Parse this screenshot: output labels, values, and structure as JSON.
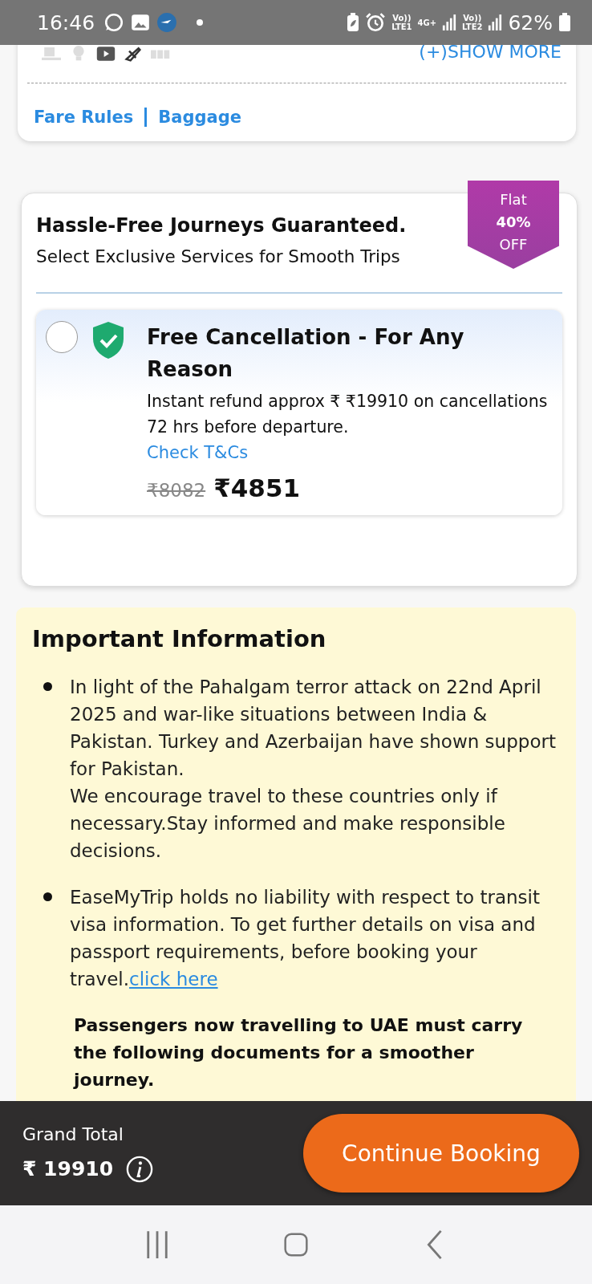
{
  "status_bar": {
    "time": "16:46",
    "network_1": [
      "Vo))",
      "LTE1"
    ],
    "network_type": "4G+",
    "network_2": [
      "Vo))",
      "LTE2"
    ],
    "battery": "62%"
  },
  "flight_card": {
    "show_more": "(+)SHOW MORE",
    "links": [
      "Fare Rules",
      "Baggage"
    ]
  },
  "offer_card": {
    "title": "Hassle-Free Journeys Guaranteed.",
    "subtitle": "Select Exclusive Services for Smooth Trips",
    "badge": [
      "Flat",
      "40%",
      "OFF"
    ],
    "option": {
      "selected": false,
      "title": "Free Cancellation - For Any Reason",
      "description": "Instant refund approx ₹ ₹19910 on cancellations 72 hrs before departure.",
      "link": "Check T&Cs",
      "old_price": "₹8082",
      "price": "₹4851"
    }
  },
  "important_information": {
    "title": "Important Information",
    "items": [
      {
        "paragraphs": [
          "In light of the Pahalgam terror attack on 22nd April 2025 and war-like situations between India & Pakistan. Turkey and Azerbaijan have shown support for Pakistan.",
          "We encourage travel to these countries only if necessary.Stay informed and make responsible decisions."
        ]
      },
      {
        "paragraphs": [
          "EaseMyTrip holds no liability with respect to transit visa information. To get further details on visa and passport requirements, before booking your travel."
        ],
        "link": "click here"
      }
    ],
    "note": "Passengers now travelling to UAE must carry the following documents for a smoother journey."
  },
  "bottom_bar": {
    "label": "Grand Total",
    "total": "₹ 19910",
    "button": "Continue Booking"
  }
}
